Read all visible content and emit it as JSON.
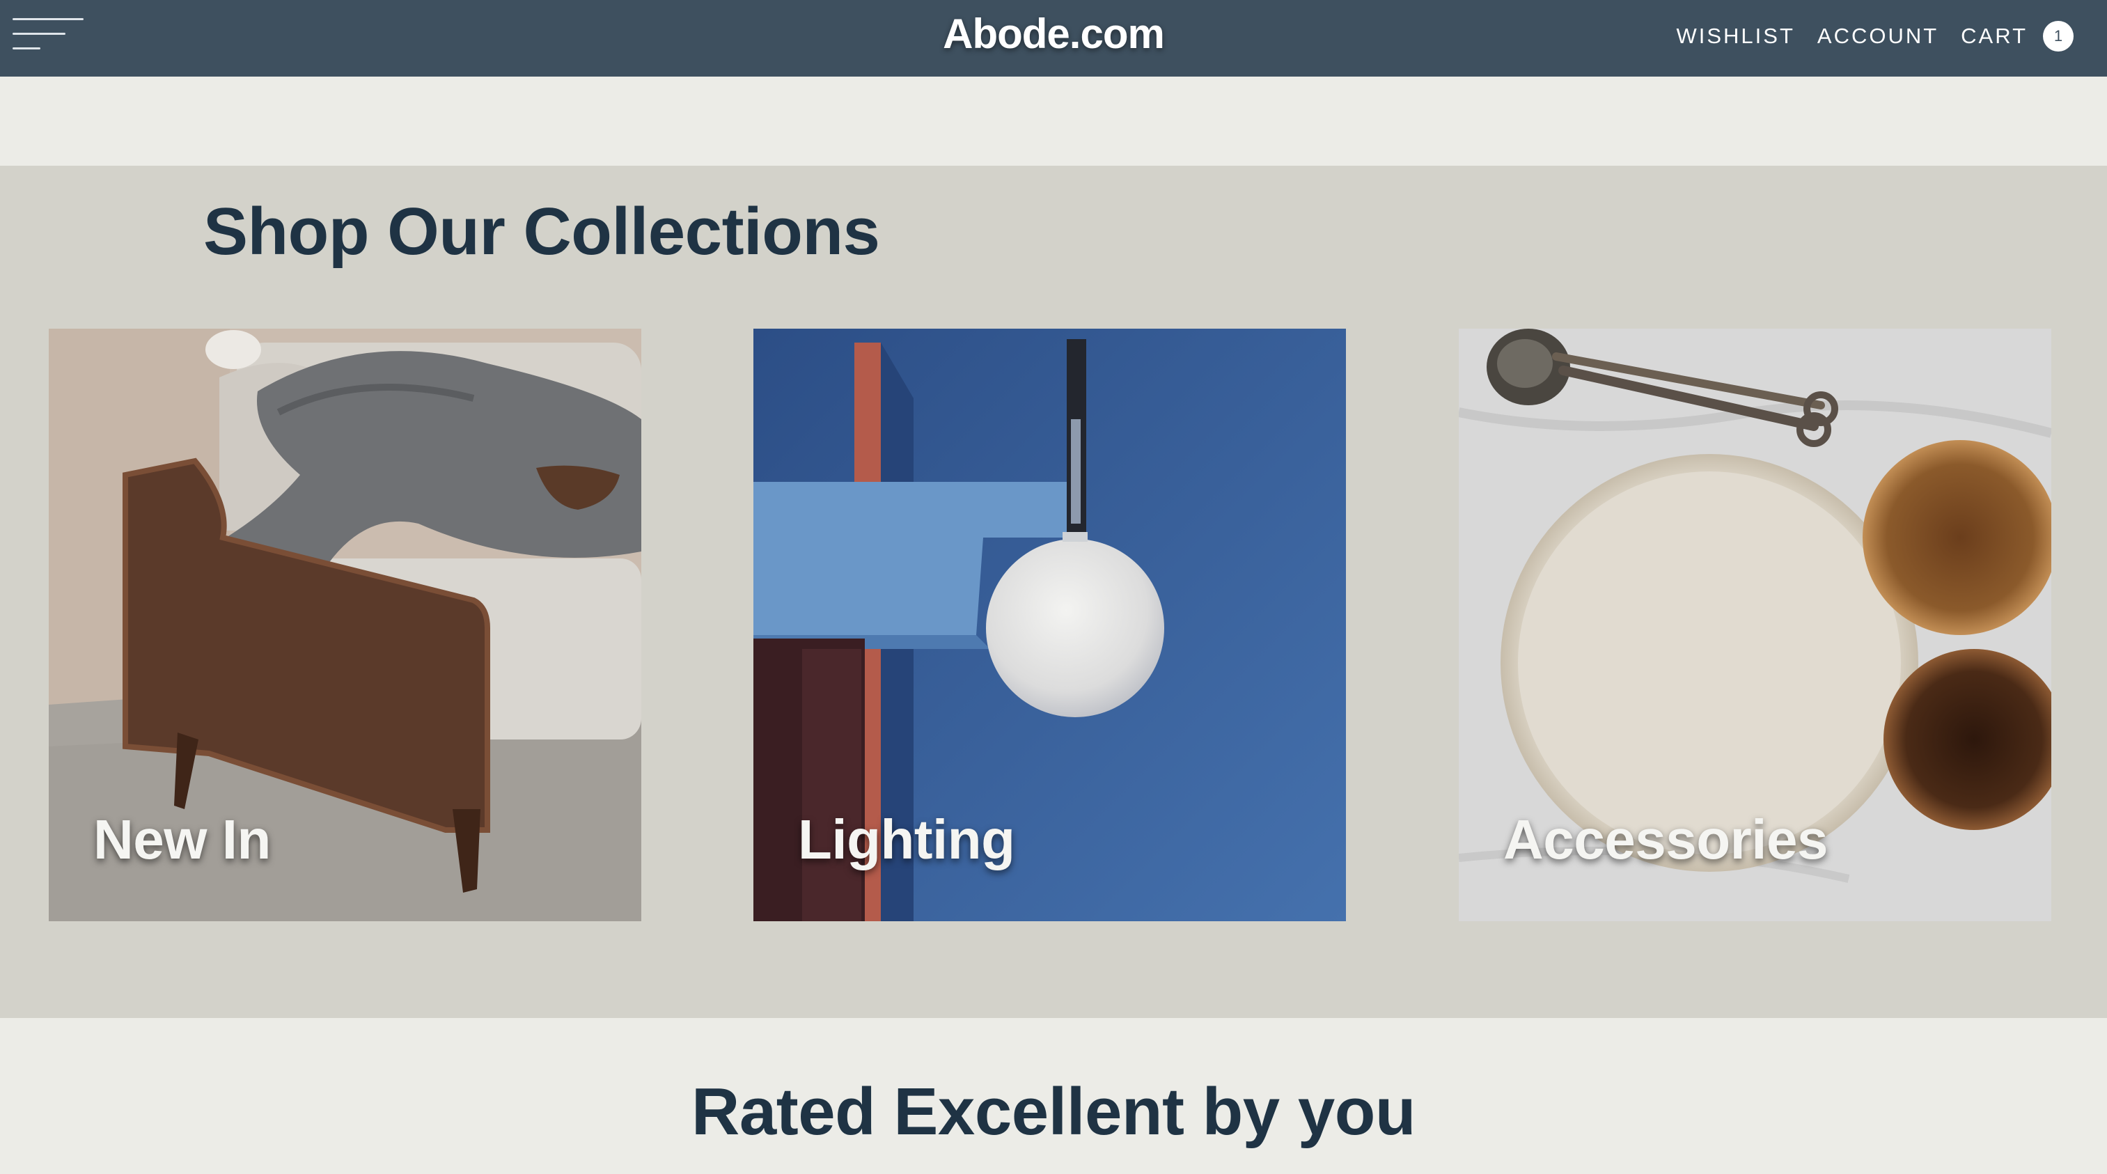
{
  "header": {
    "brand": "Abode.com",
    "nav": {
      "wishlist": "WISHLIST",
      "account": "ACCOUNT",
      "cart": "CART",
      "cart_count": "1"
    }
  },
  "collections": {
    "title": "Shop Our Collections",
    "cards": [
      {
        "label": "New In"
      },
      {
        "label": "Lighting"
      },
      {
        "label": "Accessories"
      }
    ]
  },
  "rated": {
    "title": "Rated Excellent by you"
  },
  "colors": {
    "header_bg": "#3e505f",
    "page_bg": "#ecece7",
    "collections_bg": "#d3d2ca",
    "heading_text": "#1f3344"
  },
  "icons": {
    "menu": "hamburger-menu-icon"
  }
}
